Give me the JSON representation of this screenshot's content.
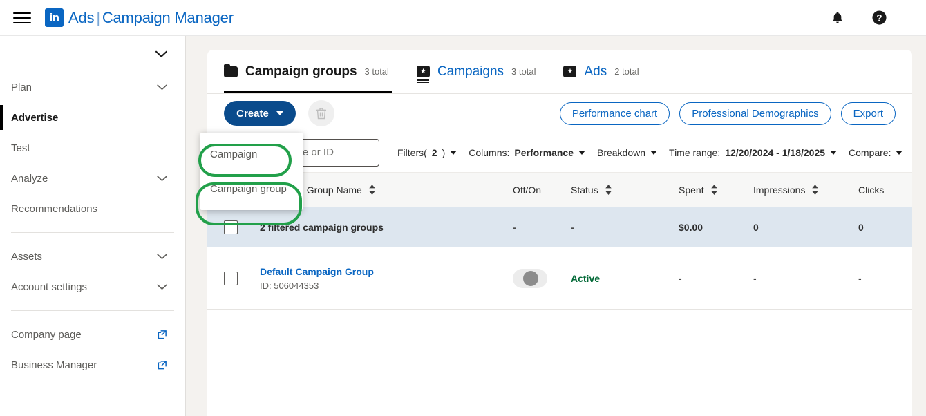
{
  "topbar": {
    "menu_icon": "hamburger-icon",
    "logo_text": "in",
    "brand_primary": "Ads",
    "brand_separator": "|",
    "brand_secondary": "Campaign Manager",
    "notifications_icon": "bell-icon",
    "help_icon": "question-circle-icon"
  },
  "sidebar": {
    "account_chevron": "chevron-down-icon",
    "items": [
      {
        "label": "Plan",
        "chevron": true,
        "active": false
      },
      {
        "label": "Advertise",
        "chevron": false,
        "active": true
      },
      {
        "label": "Test",
        "chevron": false,
        "active": false
      },
      {
        "label": "Analyze",
        "chevron": true,
        "active": false
      },
      {
        "label": "Recommendations",
        "chevron": false,
        "active": false
      }
    ],
    "items2": [
      {
        "label": "Assets",
        "chevron": true
      },
      {
        "label": "Account settings",
        "chevron": true
      }
    ],
    "external": [
      {
        "label": "Company page"
      },
      {
        "label": "Business Manager"
      }
    ]
  },
  "tabs": [
    {
      "label": "Campaign groups",
      "count": "3 total",
      "icon": "folder-icon",
      "active": true
    },
    {
      "label": "Campaigns",
      "count": "3 total",
      "icon": "campaign-badge-icon",
      "active": false
    },
    {
      "label": "Ads",
      "count": "2 total",
      "icon": "ad-badge-icon",
      "active": false
    }
  ],
  "toolbar": {
    "create_label": "Create",
    "delete_icon": "trash-icon",
    "performance_chart": "Performance chart",
    "professional_demographics": "Professional Demographics",
    "export": "Export"
  },
  "create_menu": {
    "items": [
      {
        "label": "Campaign"
      },
      {
        "label": "Campaign group"
      }
    ]
  },
  "filters": {
    "search_placeholder": "Search by name or ID",
    "search_value": "",
    "filters_label": "Filters(",
    "filters_count": "2",
    "filters_label_end": ")",
    "columns_label": "Columns:",
    "columns_value": "Performance",
    "breakdown_label": "Breakdown",
    "time_range_label": "Time range:",
    "time_range_value": "12/20/2024 - 1/18/2025",
    "compare_label": "Compare:"
  },
  "table": {
    "columns": [
      {
        "label": "Campaign Group Name",
        "sortable": true
      },
      {
        "label": "Off/On",
        "sortable": false
      },
      {
        "label": "Status",
        "sortable": true
      },
      {
        "label": "Spent",
        "sortable": true
      },
      {
        "label": "Impressions",
        "sortable": true
      },
      {
        "label": "Clicks",
        "sortable": false
      }
    ],
    "summary_row": {
      "name": "2 filtered campaign groups",
      "off_on": "-",
      "status": "-",
      "spent": "$0.00",
      "impressions": "0",
      "clicks": "0"
    },
    "rows": [
      {
        "name": "Default Campaign Group",
        "id": "ID: 506044353",
        "status": "Active",
        "spent": "-",
        "impressions": "-",
        "clicks": "-"
      }
    ]
  },
  "colors": {
    "brand_blue": "#0a66c2",
    "create_blue": "#0a4b8c",
    "annotation_green": "#22a04a",
    "status_green": "#046a38",
    "summary_row_bg": "#dde6ef"
  }
}
